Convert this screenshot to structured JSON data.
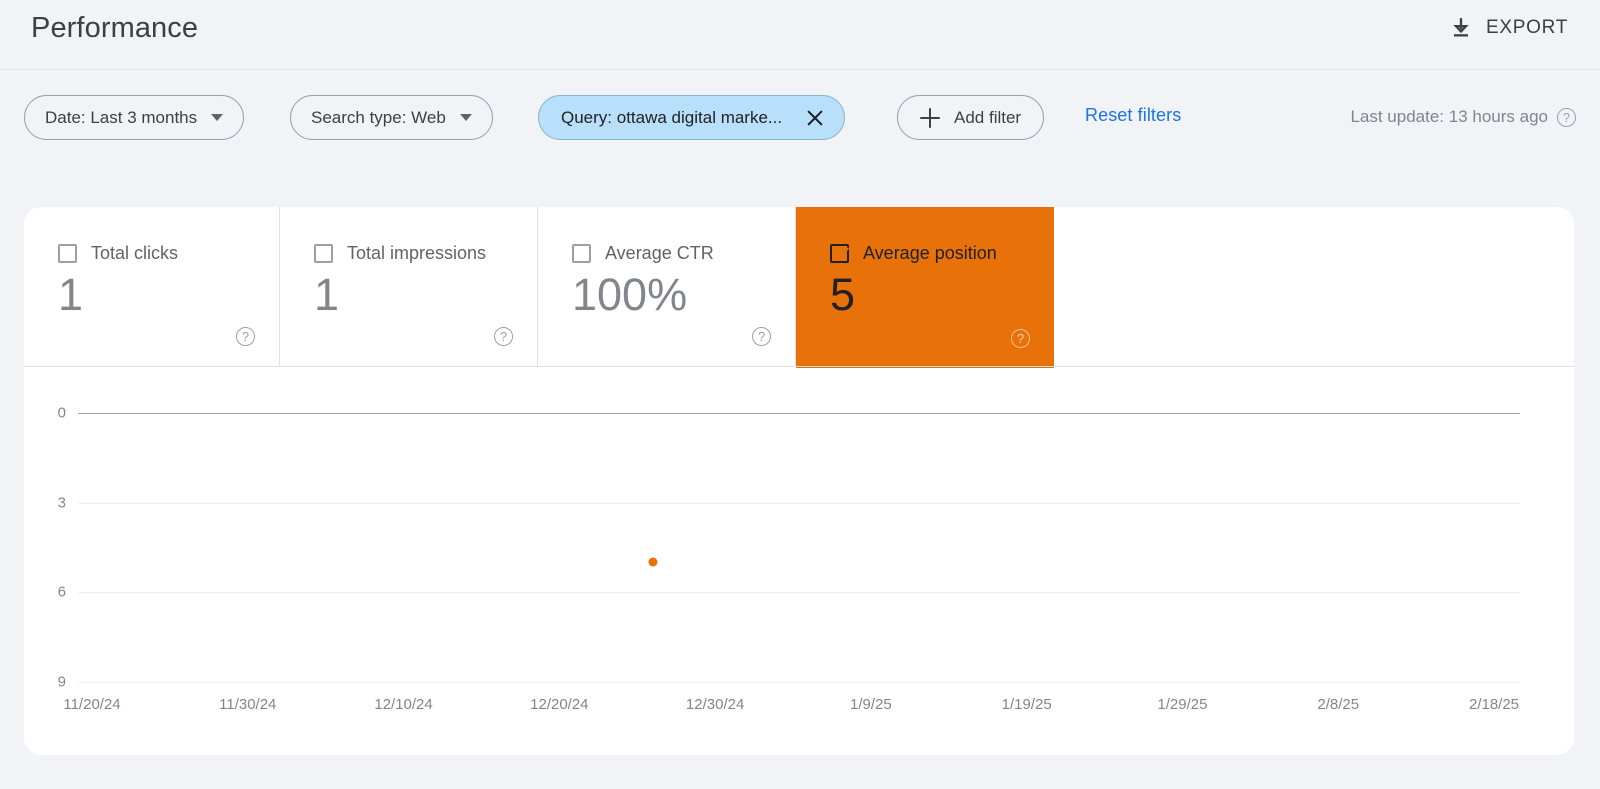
{
  "header": {
    "title": "Performance",
    "export_label": "EXPORT",
    "export_icon": "download-icon"
  },
  "filters": {
    "chips": [
      {
        "id": "date",
        "label": "Date: Last 3 months",
        "icon": "chevron-down-icon",
        "active": false
      },
      {
        "id": "searchtype",
        "label": "Search type: Web",
        "icon": "chevron-down-icon",
        "active": false
      },
      {
        "id": "query",
        "label": "Query: ottawa digital marke...",
        "icon": "close-icon",
        "active": true
      },
      {
        "id": "addfilter",
        "label": "Add filter",
        "icon": "plus-icon",
        "active": false
      }
    ],
    "reset_label": "Reset filters",
    "last_update": "Last update: 13 hours ago",
    "help_icon": "help-icon",
    "accent_blue": "#1a73e8",
    "chip_active_bg": "#b9e0fb"
  },
  "metrics": [
    {
      "id": "clicks",
      "label": "Total clicks",
      "value": "1",
      "checked": false,
      "help_icon": "help-icon"
    },
    {
      "id": "impressions",
      "label": "Total impressions",
      "value": "1",
      "checked": false,
      "help_icon": "help-icon"
    },
    {
      "id": "ctr",
      "label": "Average CTR",
      "value": "100%",
      "checked": false,
      "help_icon": "help-icon"
    },
    {
      "id": "position",
      "label": "Average position",
      "value": "5",
      "checked": true,
      "help_icon": "help-icon"
    }
  ],
  "colors": {
    "orange": "#e8710a",
    "page_bg": "#f1f3f7",
    "panel_bg": "#ffffff"
  },
  "chart_data": {
    "type": "scatter",
    "title": "",
    "xlabel": "",
    "ylabel": "",
    "series": [
      {
        "name": "Average position",
        "color": "#e8710a",
        "points": [
          {
            "x": "12/26/24",
            "y": 5
          }
        ]
      }
    ],
    "x_ticks": [
      "11/20/24",
      "11/30/24",
      "12/10/24",
      "12/20/24",
      "12/30/24",
      "1/9/25",
      "1/19/25",
      "1/29/25",
      "2/8/25",
      "2/18/25"
    ],
    "y_ticks": [
      0,
      3,
      6,
      9
    ],
    "ylim": [
      0,
      9
    ],
    "y_inverted": true,
    "grid": true,
    "legend": "none"
  }
}
